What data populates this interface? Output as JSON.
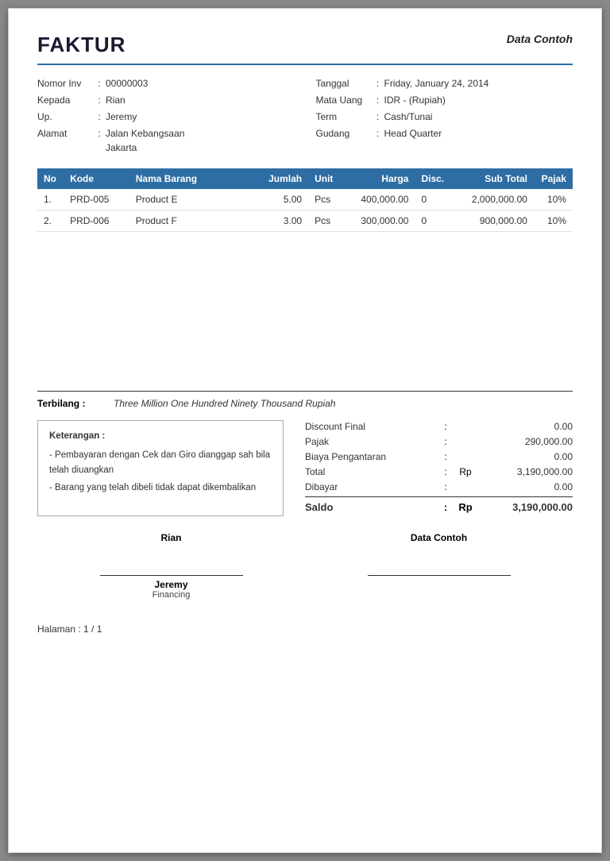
{
  "header": {
    "title": "FAKTUR",
    "subtitle": "Data Contoh"
  },
  "invoice_info": {
    "left": {
      "nomor_label": "Nomor Inv",
      "nomor_value": "00000003",
      "kepada_label": "Kepada",
      "kepada_value": "Rian",
      "up_label": "Up.",
      "up_value": "Jeremy",
      "alamat_label": "Alamat",
      "alamat_line1": "Jalan Kebangsaan",
      "alamat_line2": "Jakarta"
    },
    "right": {
      "tanggal_label": "Tanggal",
      "tanggal_value": "Friday, January 24, 2014",
      "mata_uang_label": "Mata Uang",
      "mata_uang_value": "IDR - (Rupiah)",
      "term_label": "Term",
      "term_value": "Cash/Tunai",
      "gudang_label": "Gudang",
      "gudang_value": "Head Quarter"
    }
  },
  "table": {
    "columns": [
      "No",
      "Kode",
      "Nama Barang",
      "Jumlah",
      "Unit",
      "Harga",
      "Disc.",
      "Sub Total",
      "Pajak"
    ],
    "rows": [
      {
        "no": "1.",
        "kode": "PRD-005",
        "nama_barang": "Product E",
        "jumlah": "5.00",
        "unit": "Pcs",
        "harga": "400,000.00",
        "disc": "0",
        "sub_total": "2,000,000.00",
        "pajak": "10%"
      },
      {
        "no": "2.",
        "kode": "PRD-006",
        "nama_barang": "Product F",
        "jumlah": "3.00",
        "unit": "Pcs",
        "harga": "300,000.00",
        "disc": "0",
        "sub_total": "900,000.00",
        "pajak": "10%"
      }
    ]
  },
  "terbilang": {
    "label": "Terbilang :",
    "value": "Three Million One Hundred Ninety Thousand Rupiah"
  },
  "keterangan": {
    "title": "Keterangan :",
    "lines": [
      "- Pembayaran dengan Cek dan Giro dianggap sah bila telah diuangkan",
      "- Barang yang telah dibeli tidak dapat dikembalikan"
    ]
  },
  "summary": {
    "discount_final_label": "Discount Final",
    "discount_final_value": "0.00",
    "pajak_label": "Pajak",
    "pajak_value": "290,000.00",
    "biaya_pengantaran_label": "Biaya Pengantaran",
    "biaya_pengantaran_value": "0.00",
    "total_label": "Total",
    "total_rp": "Rp",
    "total_value": "3,190,000.00",
    "dibayar_label": "Dibayar",
    "dibayar_value": "0.00",
    "saldo_label": "Saldo",
    "saldo_rp": "Rp",
    "saldo_value": "3,190,000.00"
  },
  "signatures": {
    "top_left": "Rian",
    "top_right": "Data Contoh",
    "bottom_name": "Jeremy",
    "bottom_role": "Financing"
  },
  "pagination": {
    "label": "Halaman : 1 / 1"
  }
}
